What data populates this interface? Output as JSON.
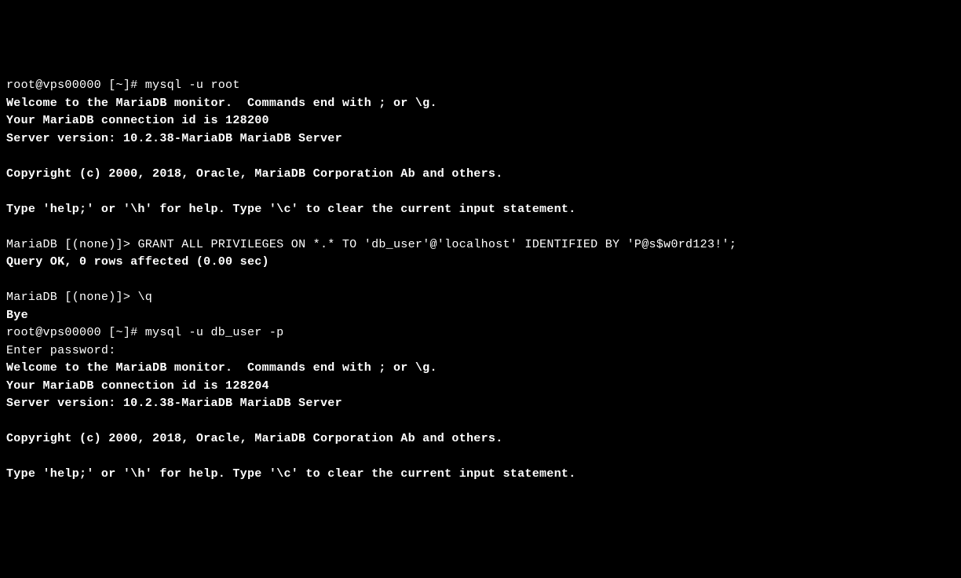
{
  "terminal": {
    "line1_prompt": "root@vps00000 [~]# ",
    "line1_cmd": "mysql -u root",
    "line2": "Welcome to the MariaDB monitor.  Commands end with ; or \\g.",
    "line3": "Your MariaDB connection id is 128200",
    "line4": "Server version: 10.2.38-MariaDB MariaDB Server",
    "line5": "",
    "line6": "Copyright (c) 2000, 2018, Oracle, MariaDB Corporation Ab and others.",
    "line7": "",
    "line8": "Type 'help;' or '\\h' for help. Type '\\c' to clear the current input statement.",
    "line9": "",
    "line10_prompt": "MariaDB [(none)]> ",
    "line10_cmd": "GRANT ALL PRIVILEGES ON *.* TO 'db_user'@'localhost' IDENTIFIED BY 'P@s$w0rd123!';",
    "line11": "Query OK, 0 rows affected (0.00 sec)",
    "line12": "",
    "line13_prompt": "MariaDB [(none)]> ",
    "line13_cmd": "\\q",
    "line14": "Bye",
    "line15_prompt": "root@vps00000 [~]# ",
    "line15_cmd": "mysql -u db_user -p",
    "line16": "Enter password:",
    "line17": "Welcome to the MariaDB monitor.  Commands end with ; or \\g.",
    "line18": "Your MariaDB connection id is 128204",
    "line19": "Server version: 10.2.38-MariaDB MariaDB Server",
    "line20": "",
    "line21": "Copyright (c) 2000, 2018, Oracle, MariaDB Corporation Ab and others.",
    "line22": "",
    "line23": "Type 'help;' or '\\h' for help. Type '\\c' to clear the current input statement."
  }
}
